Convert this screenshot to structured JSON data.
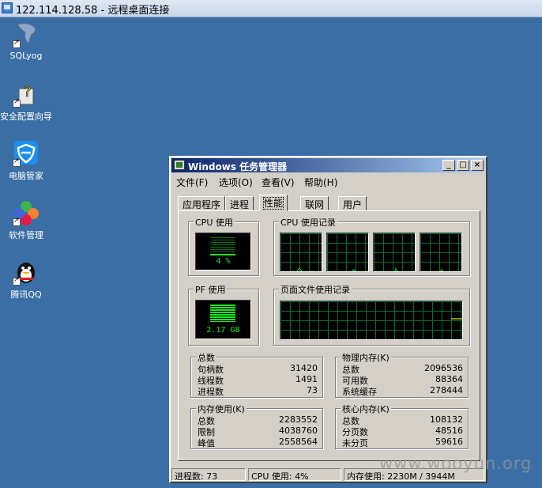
{
  "remote_bar": {
    "title": "122.114.128.58 - 远程桌面连接"
  },
  "desktop": {
    "icons": [
      {
        "label": "SQLyog"
      },
      {
        "label": "安全配置向导"
      },
      {
        "label": "电脑管家"
      },
      {
        "label": "软件管理"
      },
      {
        "label": "腾讯QQ"
      }
    ]
  },
  "taskmgr": {
    "title": "Windows 任务管理器",
    "menu": [
      "文件(F)",
      "选项(O)",
      "查看(V)",
      "帮助(H)"
    ],
    "tabs": [
      "应用程序",
      "进程",
      "性能",
      "联网",
      "用户"
    ],
    "active_tab": "性能",
    "cpu_usage": {
      "title": "CPU 使用",
      "value": "4 %",
      "percent": 4
    },
    "cpu_history": {
      "title": "CPU 使用记录"
    },
    "pf_usage": {
      "title": "PF 使用",
      "value": "2.17 GB"
    },
    "pf_history": {
      "title": "页面文件使用记录"
    },
    "totals": {
      "title": "总数",
      "rows": [
        {
          "label": "句柄数",
          "value": "31420"
        },
        {
          "label": "线程数",
          "value": "1491"
        },
        {
          "label": "进程数",
          "value": "73"
        }
      ]
    },
    "physical_memory": {
      "title": "物理内存(K)",
      "rows": [
        {
          "label": "总数",
          "value": "2096536"
        },
        {
          "label": "可用数",
          "value": "88364"
        },
        {
          "label": "系统缓存",
          "value": "278444"
        }
      ]
    },
    "commit_charge": {
      "title": "内存使用(K)",
      "rows": [
        {
          "label": "总数",
          "value": "2283552"
        },
        {
          "label": "限制",
          "value": "4038760"
        },
        {
          "label": "峰值",
          "value": "2558564"
        }
      ]
    },
    "kernel_memory": {
      "title": "核心内存(K)",
      "rows": [
        {
          "label": "总数",
          "value": "108132"
        },
        {
          "label": "分页数",
          "value": "48516"
        },
        {
          "label": "未分页",
          "value": "59616"
        }
      ]
    },
    "status": {
      "processes": "进程数: 73",
      "cpu": "CPU 使用: 4%",
      "memory": "内存使用: 2230M / 3944M"
    }
  },
  "watermark": "www.wooyun.org",
  "colors": {
    "desktop": "#3a6ea5",
    "graph_line": "#27e327",
    "grid": "#0b6b36",
    "titlebar": "#0a246a"
  }
}
